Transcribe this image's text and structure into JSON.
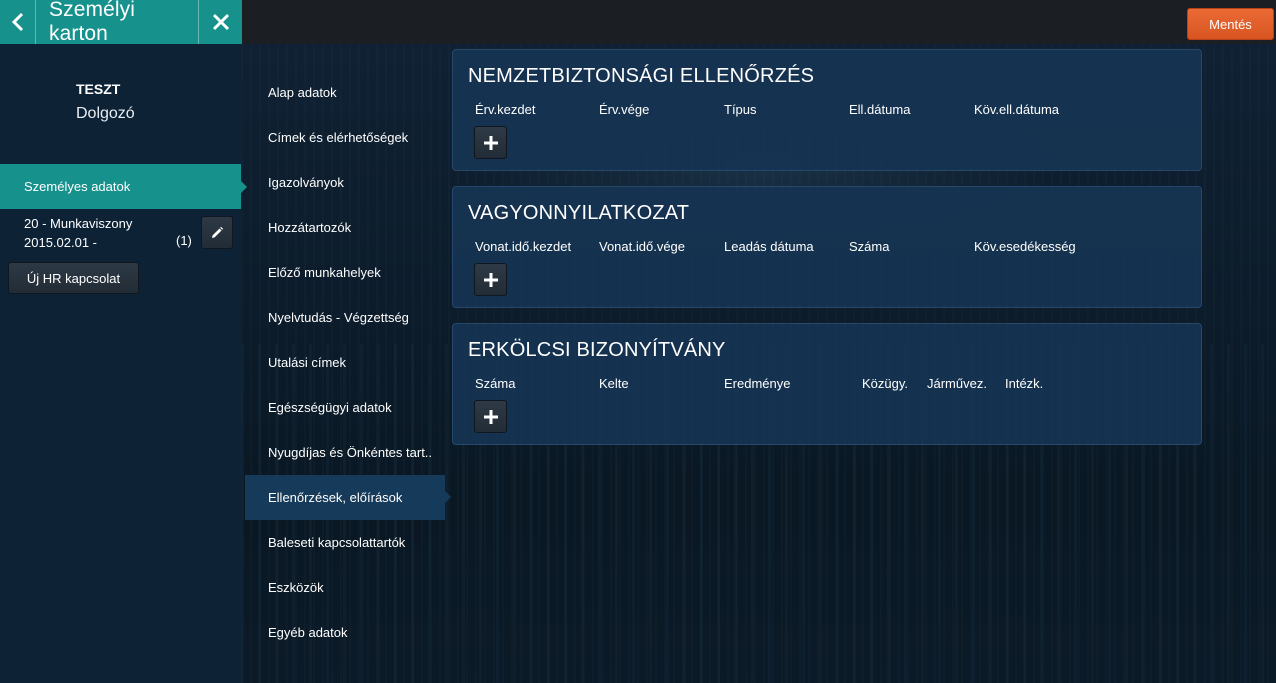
{
  "header": {
    "title": "Személyi karton",
    "back_icon": "chevron-left-icon",
    "close_icon": "close-icon",
    "save_label": "Mentés",
    "accent": "#17918c",
    "save_color": "#e05d28"
  },
  "person": {
    "name": "TESZT",
    "role": "Dolgozó"
  },
  "left_nav": {
    "active_label": "Személyes adatok",
    "employment_line1": "20 - Munkaviszony",
    "employment_line2": "2015.02.01 -",
    "employment_count": "(1)",
    "edit_icon": "pencil-icon",
    "new_hr_label": "Új HR kapcsolat"
  },
  "submenu": {
    "items": [
      {
        "label": "Alap adatok"
      },
      {
        "label": "Címek és elérhetőségek"
      },
      {
        "label": "Igazolványok"
      },
      {
        "label": "Hozzátartozók"
      },
      {
        "label": "Előző munkahelyek"
      },
      {
        "label": "Nyelvtudás - Végzettség"
      },
      {
        "label": "Utalási címek"
      },
      {
        "label": "Egészségügyi adatok"
      },
      {
        "label": "Nyugdíjas és Önkéntes tart.."
      },
      {
        "label": "Ellenőrzések, előírások"
      },
      {
        "label": "Baleseti kapcsolattartók"
      },
      {
        "label": "Eszközök"
      },
      {
        "label": "Egyéb adatok"
      }
    ],
    "active_index": 9
  },
  "sections": [
    {
      "title": "NEMZETBIZTONSÁGI ELLENŐRZÉS",
      "columns": [
        "Érv.kezdet",
        "Érv.vége",
        "Típus",
        "Ell.dátuma",
        "Köv.ell.dátuma"
      ],
      "add_icon": "plus-icon"
    },
    {
      "title": "VAGYONNYILATKOZAT",
      "columns": [
        "Vonat.idő.kezdet",
        "Vonat.idő.vége",
        "Leadás dátuma",
        "Száma",
        "Köv.esedékesség"
      ],
      "add_icon": "plus-icon"
    },
    {
      "title": "ERKÖLCSI BIZONYÍTVÁNY",
      "columns": [
        "Száma",
        "Kelte",
        "Eredménye",
        "Közügy.",
        "Járművez.",
        "Intézk."
      ],
      "add_icon": "plus-icon"
    }
  ]
}
